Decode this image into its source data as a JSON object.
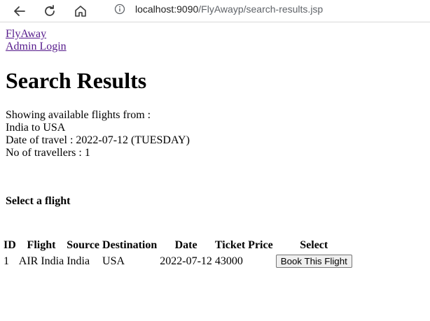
{
  "browser": {
    "url_host": "localhost:9090",
    "url_path": "/FlyAwayp/search-results.jsp"
  },
  "nav": {
    "home_link": "FlyAway",
    "admin_link": "Admin Login"
  },
  "page": {
    "title": "Search Results",
    "showing_line": "Showing available flights from :",
    "route_line": "India to USA",
    "date_line": "Date of travel : 2022-07-12 (TUESDAY)",
    "travellers_line": "No of travellers : 1",
    "select_heading": "Select a flight"
  },
  "table": {
    "headers": [
      "ID",
      "Flight",
      "Source",
      "Destination",
      "Date",
      "Ticket Price",
      "Select"
    ],
    "rows": [
      {
        "id": "1",
        "flight": "AIR India",
        "source": "India",
        "destination": "USA",
        "date": "2022-07-12",
        "price": "43000",
        "action": "Book This Flight"
      }
    ]
  }
}
